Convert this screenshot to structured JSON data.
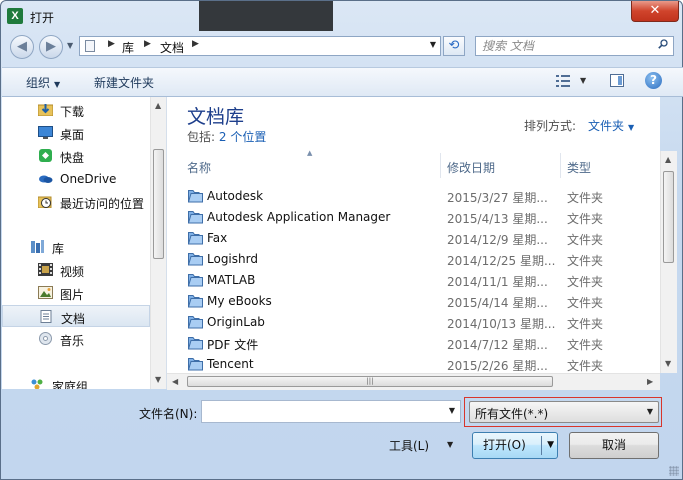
{
  "window": {
    "title": "打开",
    "close_symbol": "✕",
    "app_icon_letter": "X"
  },
  "address_bar": {
    "back_symbol": "◀",
    "forward_symbol": "▶",
    "path": [
      "库",
      "文档"
    ],
    "refresh_symbol": "⟲",
    "search_placeholder": "搜索 文档"
  },
  "toolbar": {
    "organize_label": "组织",
    "new_folder_label": "新建文件夹",
    "help_symbol": "?"
  },
  "nav_pane": {
    "items": [
      {
        "label": "下载",
        "icon": "download-folder-icon"
      },
      {
        "label": "桌面",
        "icon": "desktop-icon"
      },
      {
        "label": "快盘",
        "icon": "kuaipan-icon"
      },
      {
        "label": "OneDrive",
        "icon": "onedrive-icon"
      },
      {
        "label": "最近访问的位置",
        "icon": "recent-places-icon"
      }
    ],
    "libraries": {
      "label": "库",
      "items": [
        {
          "label": "视频",
          "icon": "video-icon"
        },
        {
          "label": "图片",
          "icon": "pictures-icon"
        },
        {
          "label": "文档",
          "icon": "documents-icon",
          "selected": true
        },
        {
          "label": "音乐",
          "icon": "music-icon"
        }
      ]
    },
    "homegroup_label": "家庭组"
  },
  "content": {
    "library_title": "文档库",
    "includes_label": "包括:",
    "locations_link": "2 个位置",
    "sort_label": "排列方式:",
    "sort_value": "文件夹",
    "columns": {
      "name": "名称",
      "date": "修改日期",
      "type": "类型"
    },
    "rows": [
      {
        "name": "Autodesk",
        "date": "2015/3/27 星期...",
        "type": "文件夹"
      },
      {
        "name": "Autodesk Application Manager",
        "date": "2015/4/13 星期...",
        "type": "文件夹"
      },
      {
        "name": "Fax",
        "date": "2014/12/9 星期...",
        "type": "文件夹"
      },
      {
        "name": "Logishrd",
        "date": "2014/12/25 星期...",
        "type": "文件夹"
      },
      {
        "name": "MATLAB",
        "date": "2014/11/1 星期...",
        "type": "文件夹"
      },
      {
        "name": "My eBooks",
        "date": "2015/4/14 星期...",
        "type": "文件夹"
      },
      {
        "name": "OriginLab",
        "date": "2014/10/13 星期...",
        "type": "文件夹"
      },
      {
        "name": "PDF 文件",
        "date": "2014/7/12 星期...",
        "type": "文件夹"
      },
      {
        "name": "Tencent",
        "date": "2015/2/26 星期...",
        "type": "文件夹"
      }
    ]
  },
  "bottom": {
    "filename_label": "文件名(N):",
    "filename_value": "",
    "filetype_value": "所有文件(*.*)",
    "tools_label": "工具(L)",
    "open_label": "打开(O)",
    "cancel_label": "取消"
  }
}
